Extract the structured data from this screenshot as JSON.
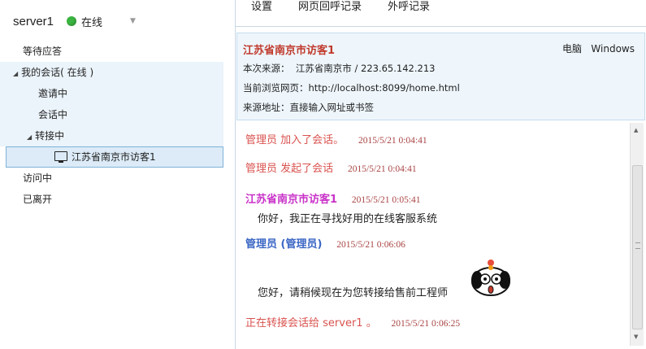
{
  "sidebar": {
    "server_name": "server1",
    "status_label": "在线",
    "status_color": "#3bb441",
    "tree": [
      {
        "label": "等待应答"
      },
      {
        "label": "我的会话( 在线 )"
      },
      {
        "label": "邀请中"
      },
      {
        "label": "会话中"
      },
      {
        "label": "转接中"
      },
      {
        "label": "江苏省南京市访客1"
      },
      {
        "label": "访问中"
      },
      {
        "label": "已离开"
      }
    ]
  },
  "tabs": [
    {
      "label": "设置"
    },
    {
      "label": "网页回呼记录"
    },
    {
      "label": "外呼记录"
    }
  ],
  "visitor_info": {
    "name": "江苏省南京市访客1",
    "device": "电脑",
    "os": "Windows",
    "source_label": "本次来源：",
    "source_value": "江苏省南京市  /  223.65.142.213",
    "page_label": "当前浏览网页：",
    "page_value": "http://localhost:8099/home.html",
    "referrer_label": "来源地址：",
    "referrer_value": "直接输入网址或书签"
  },
  "chat": {
    "messages": [
      {
        "text": "管理员  加入了会话。",
        "time": "2015/5/21 0:04:41"
      },
      {
        "text": "管理员  发起了会话",
        "time": "2015/5/21 0:04:41"
      },
      {
        "sender": "江苏省南京市访客1",
        "time": "2015/5/21 0:05:41",
        "body": "你好，我正在寻找好用的在线客服系统"
      },
      {
        "sender": "管理员  (管理员)",
        "time": "2015/5/21 0:06:06",
        "body": "您好，请稍候现在为您转接给售前工程师"
      },
      {
        "text": "正在转接会话给  server1  。",
        "time": "2015/5/21 0:06:25"
      }
    ]
  },
  "colors": {
    "system": "#d9534f",
    "visitor": "#c832c8",
    "admin": "#3a66c4",
    "accent": "#c0392b"
  }
}
